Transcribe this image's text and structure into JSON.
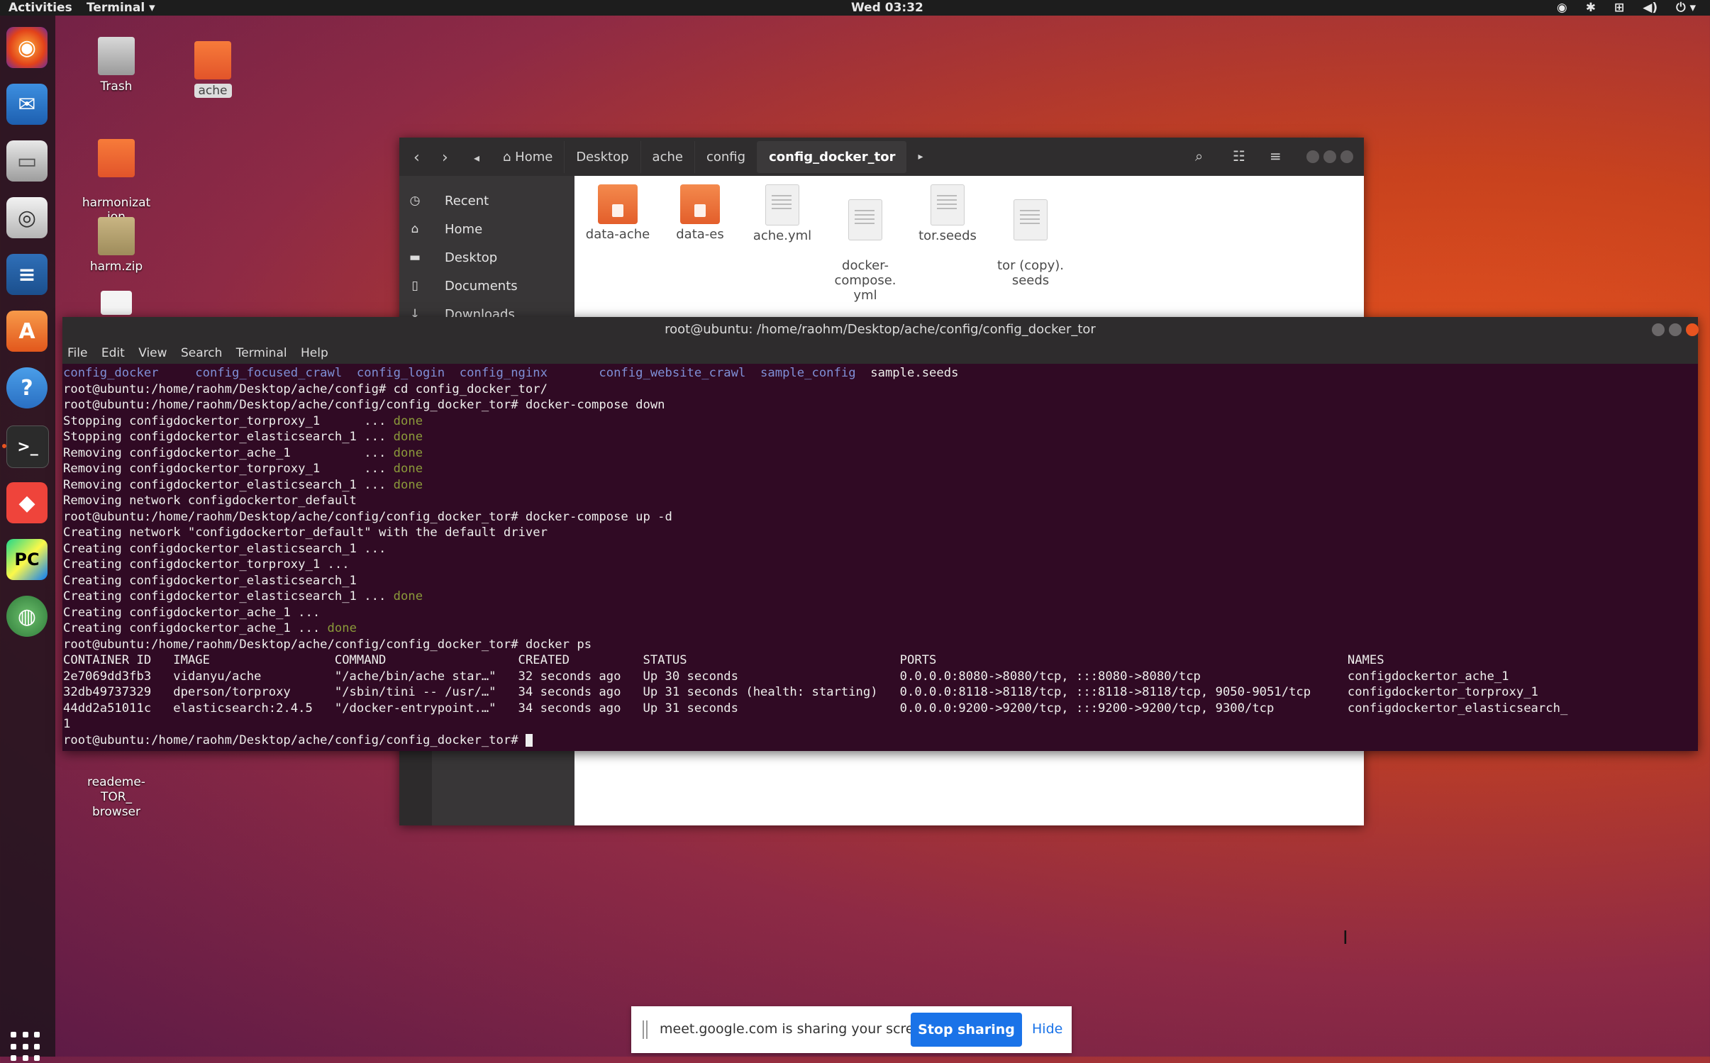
{
  "topbar": {
    "activities": "Activities",
    "app_name": "Terminal ▾",
    "clock": "Wed 03:32",
    "tray_icons": [
      "network-icon",
      "bluetooth-icon",
      "wired-network-icon",
      "volume-icon",
      "power-icon"
    ]
  },
  "dock": {
    "items": [
      "firefox-icon",
      "thunderbird-icon",
      "files-icon",
      "rhythmbox-icon",
      "writer-icon",
      "software-icon",
      "help-icon",
      "terminal-icon",
      "anydesk-icon",
      "pycharm-icon",
      "globe-icon"
    ]
  },
  "desktop": {
    "icons": [
      {
        "label": "Trash"
      },
      {
        "label": "ache"
      },
      {
        "label": "harmonizat\nion"
      },
      {
        "label": "harm.zip"
      },
      {
        "label": "reademe-\nTOR_\nbrowser"
      }
    ]
  },
  "files": {
    "breadcrumbs": [
      "Home",
      "Desktop",
      "ache",
      "config",
      "config_docker_tor"
    ],
    "sidebar": [
      "Recent",
      "Home",
      "Desktop",
      "Documents",
      "Downloads"
    ],
    "items": [
      {
        "name": "data-ache",
        "type": "folder"
      },
      {
        "name": "data-es",
        "type": "folder"
      },
      {
        "name": "ache.yml",
        "type": "file"
      },
      {
        "name": "docker-\ncompose.\nyml",
        "type": "file"
      },
      {
        "name": "tor.seeds",
        "type": "file"
      },
      {
        "name": "tor (copy).\nseeds",
        "type": "file"
      }
    ]
  },
  "terminal": {
    "title": "root@ubuntu: /home/raohm/Desktop/ache/config/config_docker_tor",
    "menu": [
      "File",
      "Edit",
      "View",
      "Search",
      "Terminal",
      "Help"
    ],
    "lines": [
      {
        "segs": [
          {
            "t": "config_docker     config_focused_crawl  config_login  config_nginx       config_website_crawl  sample_config",
            "c": "dir"
          },
          {
            "t": "  sample.seeds",
            "c": ""
          }
        ]
      },
      {
        "segs": [
          {
            "t": "root@ubuntu:/home/raohm/Desktop/ache/config# cd config_docker_tor/",
            "c": ""
          }
        ]
      },
      {
        "segs": [
          {
            "t": "root@ubuntu:/home/raohm/Desktop/ache/config/config_docker_tor# docker-compose down",
            "c": ""
          }
        ]
      },
      {
        "segs": [
          {
            "t": "Stopping configdockertor_torproxy_1      ... ",
            "c": ""
          },
          {
            "t": "done",
            "c": "done"
          }
        ]
      },
      {
        "segs": [
          {
            "t": "Stopping configdockertor_elasticsearch_1 ... ",
            "c": ""
          },
          {
            "t": "done",
            "c": "done"
          }
        ]
      },
      {
        "segs": [
          {
            "t": "Removing configdockertor_ache_1          ... ",
            "c": ""
          },
          {
            "t": "done",
            "c": "done"
          }
        ]
      },
      {
        "segs": [
          {
            "t": "Removing configdockertor_torproxy_1      ... ",
            "c": ""
          },
          {
            "t": "done",
            "c": "done"
          }
        ]
      },
      {
        "segs": [
          {
            "t": "Removing configdockertor_elasticsearch_1 ... ",
            "c": ""
          },
          {
            "t": "done",
            "c": "done"
          }
        ]
      },
      {
        "segs": [
          {
            "t": "Removing network configdockertor_default",
            "c": ""
          }
        ]
      },
      {
        "segs": [
          {
            "t": "root@ubuntu:/home/raohm/Desktop/ache/config/config_docker_tor# docker-compose up -d",
            "c": ""
          }
        ]
      },
      {
        "segs": [
          {
            "t": "Creating network \"configdockertor_default\" with the default driver",
            "c": ""
          }
        ]
      },
      {
        "segs": [
          {
            "t": "Creating configdockertor_elasticsearch_1 ...",
            "c": ""
          }
        ]
      },
      {
        "segs": [
          {
            "t": "Creating configdockertor_torproxy_1 ...",
            "c": ""
          }
        ]
      },
      {
        "segs": [
          {
            "t": "Creating configdockertor_elasticsearch_1",
            "c": ""
          }
        ]
      },
      {
        "segs": [
          {
            "t": "Creating configdockertor_elasticsearch_1 ... ",
            "c": ""
          },
          {
            "t": "done",
            "c": "done"
          }
        ]
      },
      {
        "segs": [
          {
            "t": "Creating configdockertor_ache_1 ...",
            "c": ""
          }
        ]
      },
      {
        "segs": [
          {
            "t": "Creating configdockertor_ache_1 ... ",
            "c": ""
          },
          {
            "t": "done",
            "c": "done"
          }
        ]
      },
      {
        "segs": [
          {
            "t": "root@ubuntu:/home/raohm/Desktop/ache/config/config_docker_tor# docker ps",
            "c": ""
          }
        ]
      },
      {
        "segs": [
          {
            "t": "CONTAINER ID   IMAGE                 COMMAND                  CREATED          STATUS                             PORTS                                                        NAMES",
            "c": ""
          }
        ]
      },
      {
        "segs": [
          {
            "t": "2e7069dd3fb3   vidanyu/ache          \"/ache/bin/ache star…\"   32 seconds ago   Up 30 seconds                      0.0.0.0:8080->8080/tcp, :::8080->8080/tcp                    configdockertor_ache_1",
            "c": ""
          }
        ]
      },
      {
        "segs": [
          {
            "t": "32db49737329   dperson/torproxy      \"/sbin/tini -- /usr/…\"   34 seconds ago   Up 31 seconds (health: starting)   0.0.0.0:8118->8118/tcp, :::8118->8118/tcp, 9050-9051/tcp     configdockertor_torproxy_1",
            "c": ""
          }
        ]
      },
      {
        "segs": [
          {
            "t": "44dd2a51011c   elasticsearch:2.4.5   \"/docker-entrypoint.…\"   34 seconds ago   Up 31 seconds                      0.0.0.0:9200->9200/tcp, :::9200->9200/tcp, 9300/tcp          configdockertor_elasticsearch_",
            "c": ""
          }
        ]
      },
      {
        "segs": [
          {
            "t": "1",
            "c": ""
          }
        ]
      },
      {
        "segs": [
          {
            "t": "root@ubuntu:/home/raohm/Desktop/ache/config/config_docker_tor# ",
            "c": ""
          }
        ]
      }
    ]
  },
  "share_bar": {
    "message": "meet.google.com is sharing your screen.",
    "stop_label": "Stop sharing",
    "hide_label": "Hide"
  },
  "colors": {
    "terminal_bg": "#300a24",
    "accent": "#e95420",
    "stop_button": "#1a73e8"
  }
}
